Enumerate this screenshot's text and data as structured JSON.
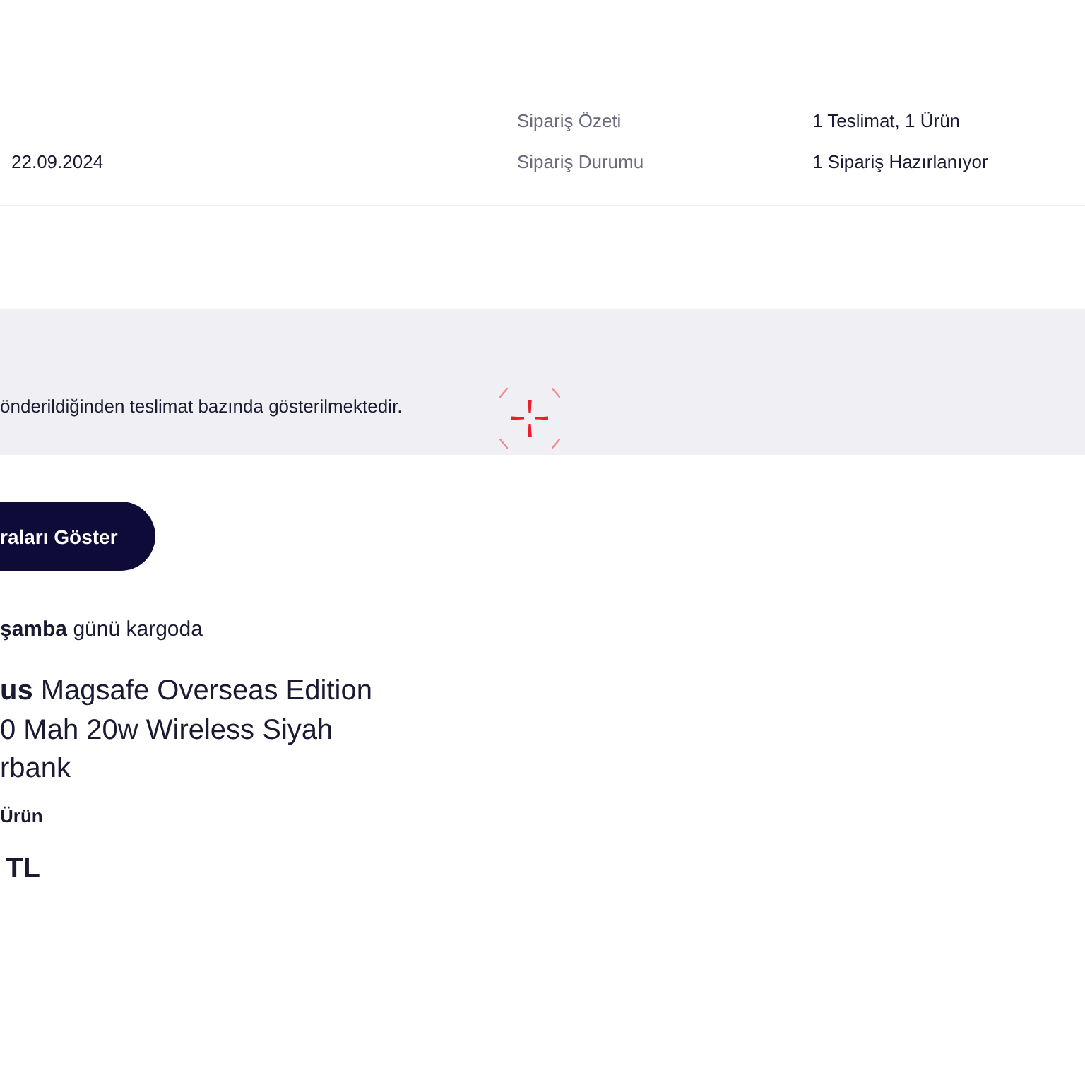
{
  "order_info": {
    "date": "22.09.2024",
    "details": [
      {
        "label": "Sipariş Özeti",
        "value": "1 Teslimat, 1 Ürün"
      },
      {
        "label": "Sipariş Durumu",
        "value": "1 Sipariş Hazırlanıyor"
      }
    ]
  },
  "notice": {
    "text": "önderildiğinden teslimat bazında gösterilmektedir."
  },
  "show_button": {
    "label": "raları Göster"
  },
  "delivery": {
    "shipping_note": "**şamba** günü kargoda",
    "product_title": "**us** Magsafe Overseas Edition 0 Mah 20w Wireless Siyah rbank",
    "quantity": "Ürün",
    "price": "TL"
  }
}
